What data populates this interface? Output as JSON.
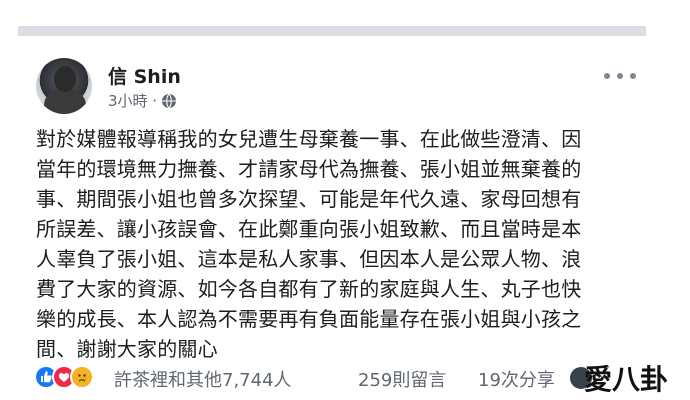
{
  "post": {
    "author_name": "信 Shin",
    "timestamp": "3小時 ·",
    "privacy_icon": "globe-icon",
    "more_icon": "more-options-icon",
    "text_lines": [
      "對於媒體報導稱我的女兒遭生母棄養一事、在此做些澄清、因",
      "當年的環境無力撫養、才請家母代為撫養、張小姐並無棄養的",
      "事、期間張小姐也曾多次探望、可能是年代久遠、家母回想有",
      "所誤差、讓小孩誤會、在此鄭重向張小姐致歉、而且當時是本",
      "人辜負了張小姐、這本是私人家事、但因本人是公眾人物、浪",
      "費了大家的資源、如今各自都有了新的家庭與人生、丸子也快",
      "樂的成長、本人認為不需要再有負面能量存在張小姐與小孩之",
      "間、謝謝大家的關心"
    ]
  },
  "footer": {
    "reactions_icons": [
      "like-icon",
      "love-icon",
      "sad-icon"
    ],
    "reaction_text": "許茶裡和其他7,744人",
    "comments_text": "259則留言",
    "shares_text": "19次分享"
  },
  "watermark": {
    "text_main": "愛八卦"
  },
  "colors": {
    "text": "#1c1e21",
    "meta": "#616770",
    "like": "#1877f2",
    "love": "#f0284a",
    "sad": "#f7b125"
  }
}
